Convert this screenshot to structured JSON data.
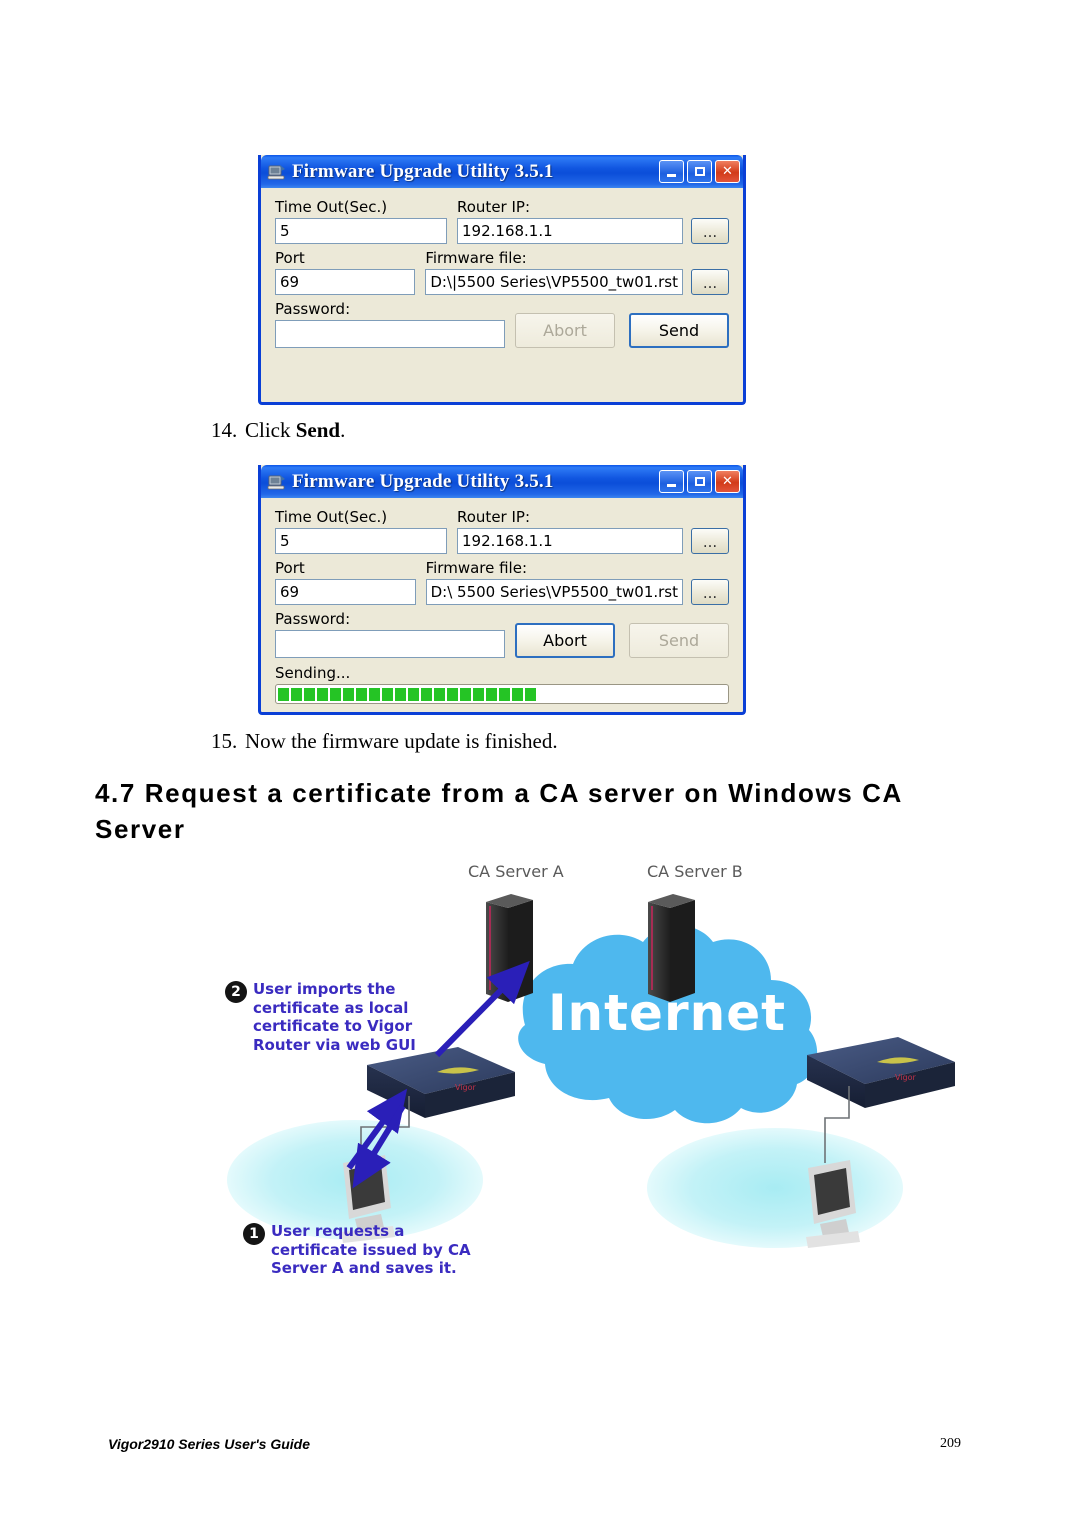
{
  "document": {
    "footer_left": "Vigor2910 Series User's Guide",
    "page_number": "209",
    "section_heading": "4.7 Request a certificate from a CA server on Windows CA Server"
  },
  "steps": [
    {
      "number": "14.",
      "text_before": "Click ",
      "bold": "Send",
      "text_after": "."
    },
    {
      "number": "15.",
      "text_before": "Now the firmware update is finished.",
      "bold": "",
      "text_after": ""
    }
  ],
  "dialog1": {
    "title": "Firmware Upgrade Utility 3.5.1",
    "icon": "firmware-upgrade-icon",
    "window_buttons": {
      "minimize": "minimize-button",
      "maximize": "maximize-button",
      "close": "close-button"
    },
    "fields": {
      "timeout_label": "Time Out(Sec.)",
      "timeout_value": "5",
      "port_label": "Port",
      "port_value": "69",
      "password_label": "Password:",
      "password_value": "",
      "router_ip_label": "Router IP:",
      "router_ip_value": "192.168.1.1",
      "firmware_file_label": "Firmware file:",
      "firmware_file_value": "D:\\|5500 Series\\VP5500_tw01.rst",
      "browse_label": "..."
    },
    "buttons": {
      "abort": "Abort",
      "send": "Send"
    },
    "abort_enabled": false,
    "send_enabled": true
  },
  "dialog2": {
    "title": "Firmware Upgrade Utility 3.5.1",
    "icon": "firmware-upgrade-icon",
    "window_buttons": {
      "minimize": "minimize-button",
      "maximize": "maximize-button",
      "close": "close-button"
    },
    "fields": {
      "timeout_label": "Time Out(Sec.)",
      "timeout_value": "5",
      "port_label": "Port",
      "port_value": "69",
      "password_label": "Password:",
      "password_value": "",
      "router_ip_label": "Router IP:",
      "router_ip_value": "192.168.1.1",
      "firmware_file_label": "Firmware file:",
      "firmware_file_value": "D:\\ 5500 Series\\VP5500_tw01.rst",
      "browse_label": "..."
    },
    "buttons": {
      "abort": "Abort",
      "send": "Send"
    },
    "abort_enabled": true,
    "send_enabled": false,
    "status_text": "Sending...",
    "progress_blocks": 20,
    "progress_color": "#25C425"
  },
  "diagram": {
    "cloud_label": "Internet",
    "server_a_label": "CA Server A",
    "server_b_label": "CA Server B",
    "callout1": {
      "number": "1",
      "text": "User requests a\ncertificate issued by CA\nServer A and saves it."
    },
    "callout2": {
      "number": "2",
      "text": "User imports the\ncertificate as local\ncertificate to Vigor\nRouter via web GUI"
    },
    "colors": {
      "cloud": "#4EB8EE",
      "callout_text": "#3A2BC0",
      "arrow": "#2A1FB8",
      "lan_ellipse": "#BFF0F4",
      "server_label": "#5A5A5A"
    }
  }
}
